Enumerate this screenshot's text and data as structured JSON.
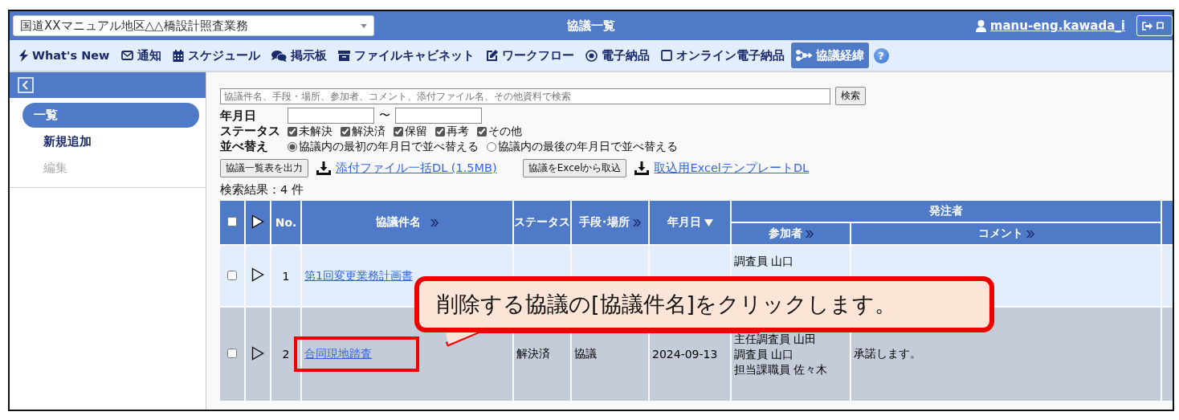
{
  "header": {
    "project_select": "国道XXマニュアル地区△△橋設計照査業務",
    "title": "協議一覧",
    "user": "manu-eng.kawada_i",
    "logout": "ロ"
  },
  "nav": [
    {
      "label": "What's New",
      "selected": false
    },
    {
      "label": "通知",
      "selected": false
    },
    {
      "label": "スケジュール",
      "selected": false
    },
    {
      "label": "掲示板",
      "selected": false
    },
    {
      "label": "ファイルキャビネット",
      "selected": false
    },
    {
      "label": "ワークフロー",
      "selected": false
    },
    {
      "label": "電子納品",
      "selected": false
    },
    {
      "label": "オンライン電子納品",
      "selected": false
    },
    {
      "label": "協議経緯",
      "selected": true
    }
  ],
  "help": "?",
  "sidebar": {
    "items": [
      {
        "label": "一覧",
        "selected": true,
        "disabled": false
      },
      {
        "label": "新規追加",
        "selected": false,
        "disabled": false
      },
      {
        "label": "編集",
        "selected": false,
        "disabled": true
      }
    ]
  },
  "search": {
    "placeholder": "協議件名、手段・場所、参加者、コメント、添付ファイル名、その他資料で検索",
    "button": "検索",
    "date_label": "年月日",
    "date_separator": "〜",
    "status_label": "ステータス",
    "statuses": [
      {
        "label": "未解決",
        "checked": true
      },
      {
        "label": "解決済",
        "checked": true
      },
      {
        "label": "保留",
        "checked": true
      },
      {
        "label": "再考",
        "checked": true
      },
      {
        "label": "その他",
        "checked": true
      }
    ],
    "sort_label": "並べ替え",
    "sort_options": [
      {
        "label": "協議内の最初の年月日で並べ替える",
        "selected": true
      },
      {
        "label": "協議内の最後の年月日で並べ替える",
        "selected": false
      }
    ]
  },
  "actions": [
    {
      "kind": "button",
      "label": "協議一覧表を出力"
    },
    {
      "kind": "link",
      "label": "添付ファイル一括DL (1.5MB)"
    },
    {
      "kind": "button",
      "label": "協議をExcelから取込"
    },
    {
      "kind": "link",
      "label": "取込用ExcelテンプレートDL"
    }
  ],
  "result_count": "検索結果：4 件",
  "table": {
    "group_header": "発注者",
    "all_checked": false,
    "columns": [
      {
        "kind": "checkbox"
      },
      {
        "kind": "expand"
      },
      {
        "kind": "text",
        "label": "No."
      },
      {
        "kind": "text",
        "label": "協議件名",
        "expandable": true
      },
      {
        "kind": "text",
        "label": "ステータス"
      },
      {
        "kind": "text",
        "label": "手段･場所",
        "expandable": true
      },
      {
        "kind": "text",
        "label": "年月日",
        "sorted": true
      },
      {
        "kind": "group",
        "label": "参加者",
        "expandable": true
      },
      {
        "kind": "group",
        "label": "コメント",
        "expandable": true
      },
      {
        "kind": "blank"
      }
    ],
    "rows": [
      {
        "checked": false,
        "no": "1",
        "title": "第1回変更業務計画書",
        "participants": [
          "調査員 山口"
        ]
      },
      {
        "checked": false,
        "no": "2",
        "title": "合同現地踏査",
        "status": "解決済",
        "means": "協議",
        "date": "2024-09-13",
        "participants": [
          "主任調査員 山田",
          "調査員 山口",
          "担当課職員 佐々木"
        ],
        "comment": "承諾します。"
      }
    ]
  },
  "callout": {
    "text": "削除する協議の[協議件名]をクリックします。"
  }
}
